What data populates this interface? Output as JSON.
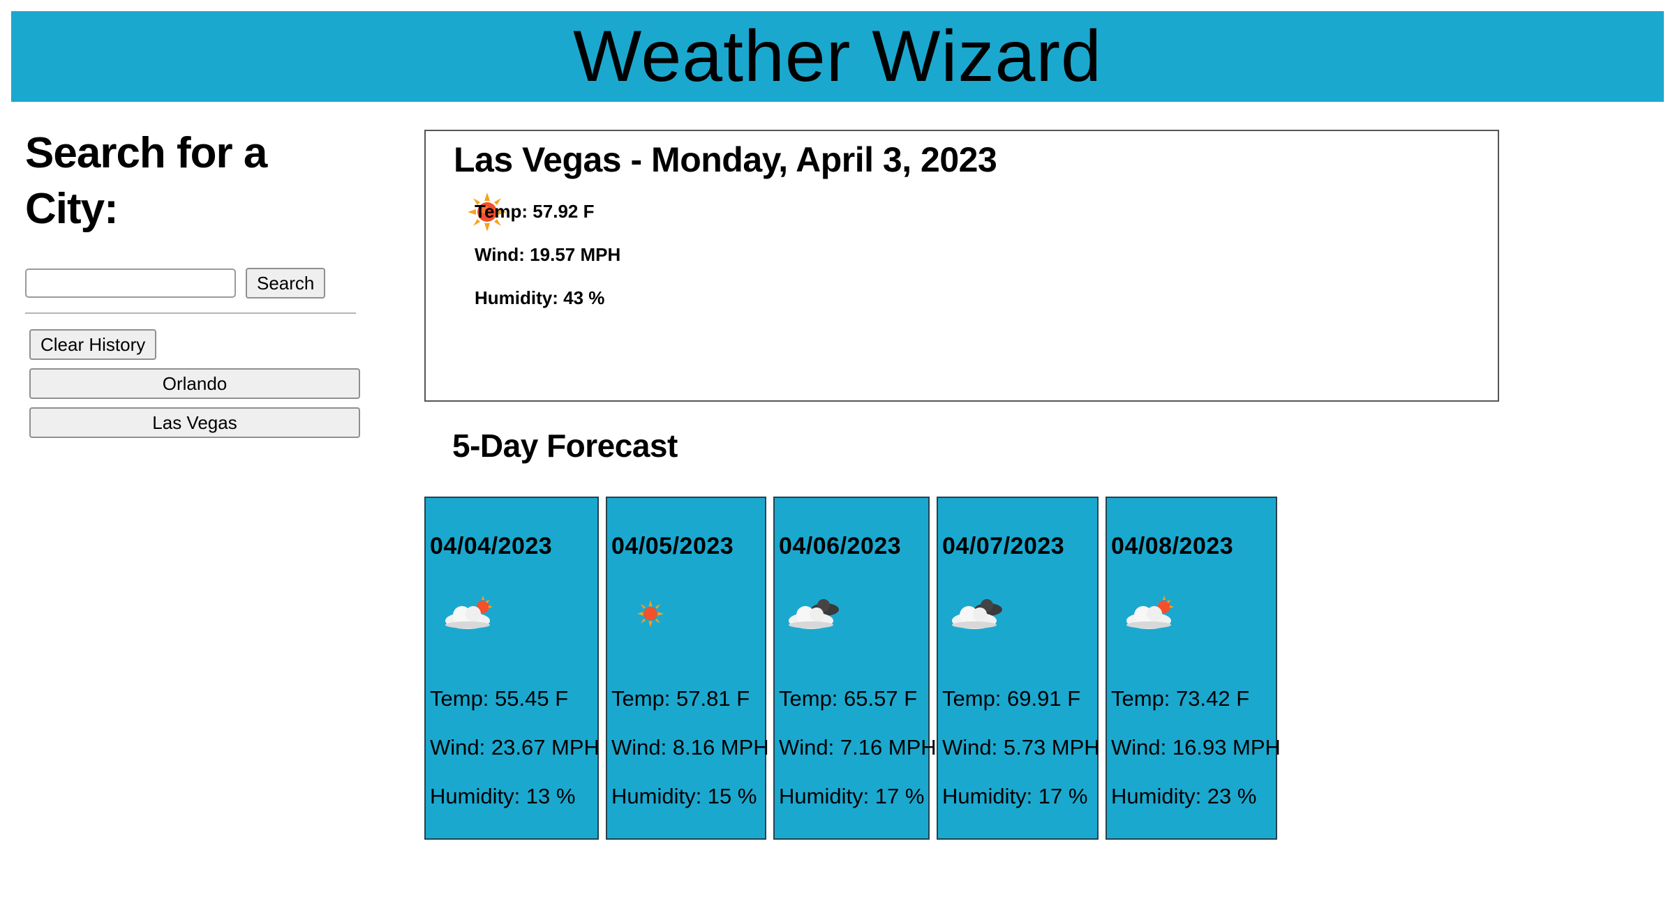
{
  "header": {
    "title": "Weather Wizard"
  },
  "sidebar": {
    "heading": "Search for a City:",
    "search": {
      "value": "",
      "placeholder": "",
      "button_label": "Search"
    },
    "clear_label": "Clear History",
    "history": [
      "Orlando",
      "Las Vegas"
    ]
  },
  "current": {
    "title": "Las Vegas - Monday, April 3, 2023",
    "icon": "sun-icon",
    "temp": "Temp: 57.92 F",
    "wind": "Wind: 19.57 MPH",
    "humidity": "Humidity: 43 %"
  },
  "forecast": {
    "title": "5-Day Forecast",
    "days": [
      {
        "date": "04/04/2023",
        "icon": "cloud-sun-icon",
        "temp": "Temp: 55.45 F",
        "wind": "Wind: 23.67 MPH",
        "humidity": "Humidity: 13 %"
      },
      {
        "date": "04/05/2023",
        "icon": "sun-icon",
        "temp": "Temp: 57.81 F",
        "wind": "Wind: 8.16 MPH",
        "humidity": "Humidity: 15 %"
      },
      {
        "date": "04/06/2023",
        "icon": "cloud-dark-icon",
        "temp": "Temp: 65.57 F",
        "wind": "Wind: 7.16 MPH",
        "humidity": "Humidity: 17 %"
      },
      {
        "date": "04/07/2023",
        "icon": "cloud-dark-icon",
        "temp": "Temp: 69.91 F",
        "wind": "Wind: 5.73 MPH",
        "humidity": "Humidity: 17 %"
      },
      {
        "date": "04/08/2023",
        "icon": "cloud-sun-icon",
        "temp": "Temp: 73.42 F",
        "wind": "Wind: 16.93 MPH",
        "humidity": "Humidity: 23 %"
      }
    ]
  },
  "colors": {
    "accent": "#1ba8cf",
    "card_border": "#24424e",
    "sun": "#f4502a"
  }
}
